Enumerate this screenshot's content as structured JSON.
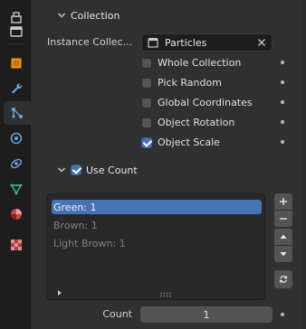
{
  "tabs": [
    {
      "icon": "tool-icon",
      "active": false
    },
    {
      "icon": "render-icon",
      "active": false
    },
    {
      "icon": "object-icon",
      "active": false
    },
    {
      "icon": "modifier-wrench-icon",
      "active": false
    },
    {
      "icon": "particles-icon",
      "active": true
    },
    {
      "icon": "physics-icon",
      "active": false
    },
    {
      "icon": "constraints-icon",
      "active": false
    },
    {
      "icon": "object-data-icon",
      "active": false
    },
    {
      "icon": "material-icon",
      "active": false
    },
    {
      "icon": "texture-icon",
      "active": false
    }
  ],
  "collection_panel": {
    "title": "Collection",
    "instance_collection_label": "Instance Collec...",
    "instance_collection_value": "Particles",
    "options": [
      {
        "label": "Whole Collection",
        "checked": false
      },
      {
        "label": "Pick Random",
        "checked": false
      },
      {
        "label": "Global Coordinates",
        "checked": false
      },
      {
        "label": "Object Rotation",
        "checked": false
      },
      {
        "label": "Object Scale",
        "checked": true
      }
    ]
  },
  "use_count_panel": {
    "title": "Use Count",
    "checked": true,
    "list_items": [
      {
        "label": "Green: 1",
        "selected": true
      },
      {
        "label": "Brown: 1",
        "selected": false
      },
      {
        "label": "Light Brown: 1",
        "selected": false
      }
    ],
    "count_label": "Count",
    "count_value": "1"
  },
  "colors": {
    "accent": "#4772b3",
    "panel_bg": "#303030",
    "field_bg": "#1d1d1d"
  }
}
